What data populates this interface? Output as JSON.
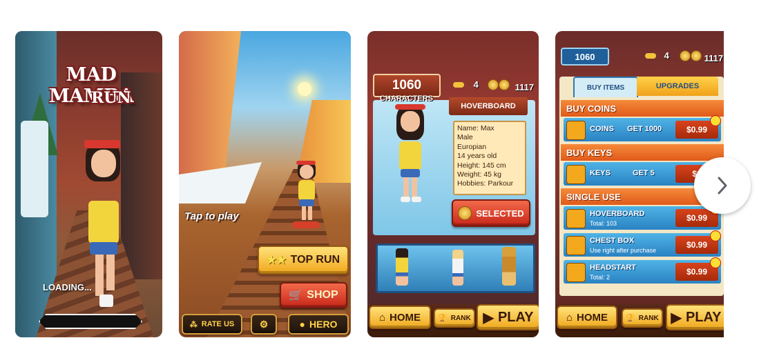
{
  "screenshots": {
    "s1": {
      "title_line1": "MAD MAMBA",
      "title_line2": "RUN",
      "loading": "LOADING..."
    },
    "s2": {
      "tap": "Tap to play",
      "top_run": "TOP RUN",
      "shop": "SHOP",
      "rate_us": "RATE US",
      "hero": "HERO"
    },
    "s3": {
      "score": "1060",
      "characters_label": "CHARACTERS",
      "keys": "4",
      "coins": "1117",
      "hoverboard_label": "HOVERBOARD",
      "info": {
        "name": "Name: Max",
        "gender": "Male",
        "origin": "Europian",
        "age": "14 years old",
        "height": "Height: 145 cm",
        "weight": "Weight: 45 kg",
        "hobbies": "Hobbies: Parkour"
      },
      "selected": "SELECTED",
      "home": "HOME",
      "rank": "RANK",
      "play": "PLAY"
    },
    "s4": {
      "score": "1060",
      "keys": "4",
      "coins": "1117",
      "tab_buy_items": "BUY ITEMS",
      "tab_upgrades": "UPGRADES",
      "section_buy_coins": "BUY COINS",
      "coins_row": {
        "name": "COINS",
        "mid": "GET 1000",
        "price": "$0.99"
      },
      "section_buy_keys": "BUY KEYS",
      "keys_row": {
        "name": "KEYS",
        "mid": "GET 5",
        "price": "$0"
      },
      "section_single_use": "SINGLE USE",
      "hoverboard_row": {
        "name": "HOVERBOARD",
        "sub": "Total: 103",
        "price": "$0.99"
      },
      "chest_row": {
        "name": "CHEST BOX",
        "sub": "Use right after purchase",
        "price": "$0.99"
      },
      "headstart_row": {
        "name": "HEADSTART",
        "sub": "Total: 2",
        "price": "$0.99"
      },
      "home": "HOME",
      "rank": "RANK",
      "play": "PLAY"
    }
  },
  "carousel": {
    "next_icon": "chevron-right-icon"
  }
}
